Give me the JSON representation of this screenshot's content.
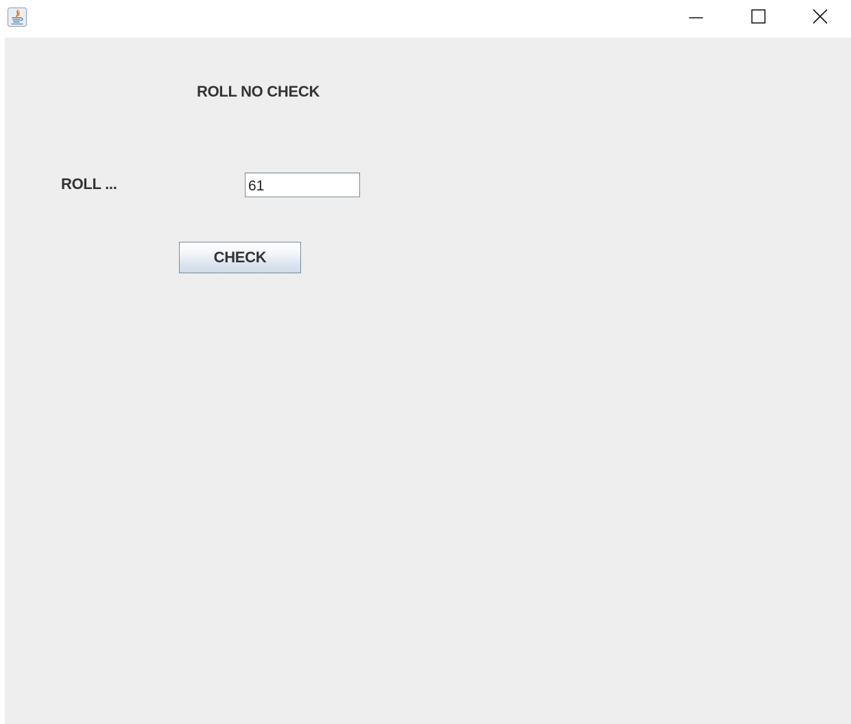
{
  "window": {
    "controls": {
      "minimize_icon": "minimize-icon",
      "maximize_icon": "maximize-icon",
      "close_icon": "close-icon"
    },
    "app_icon": "java-icon"
  },
  "form": {
    "heading": "ROLL NO CHECK",
    "roll_label": "ROLL ...",
    "roll_value": "61",
    "check_label": "CHECK"
  },
  "colors": {
    "content_background": "#eeeeee",
    "text": "#333333",
    "button_gradient_top": "#ffffff",
    "button_gradient_bottom": "#cfdbe7"
  }
}
